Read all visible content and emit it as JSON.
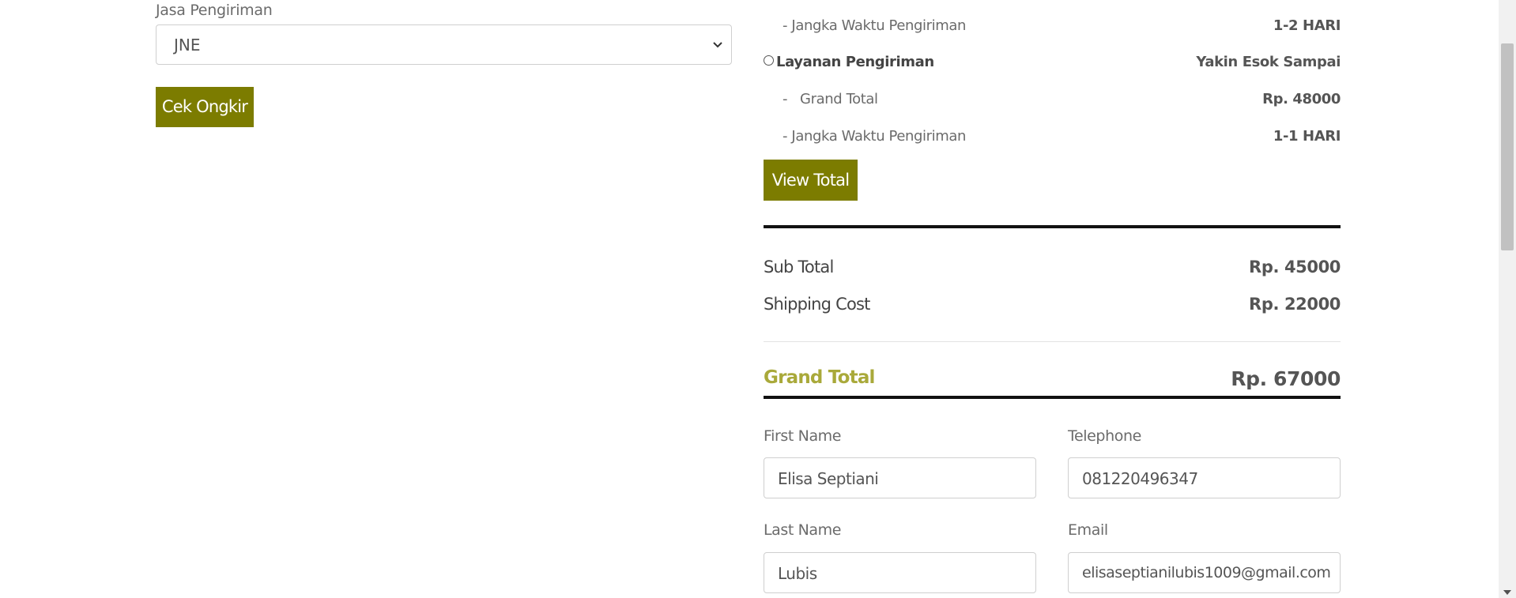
{
  "shipping_form": {
    "courier_label": "Jasa Pengiriman",
    "courier_selected": "JNE",
    "check_button": "Cek Ongkir"
  },
  "shipping_options": {
    "duration_label_1": "- Jangka Waktu Pengiriman",
    "duration_value_1": "1-2 HARI",
    "service_label": "Layanan Pengiriman",
    "service_value": "Yakin Esok Sampai",
    "grand_total_label": "-   Grand Total",
    "grand_total_value": "Rp. 48000",
    "duration_label_2": "- Jangka Waktu Pengiriman",
    "duration_value_2": "1-1 HARI",
    "view_total_button": "View Total"
  },
  "summary": {
    "subtotal_label": "Sub Total",
    "subtotal_value": "Rp. 45000",
    "shipping_label": "Shipping Cost",
    "shipping_value": "Rp. 22000",
    "grand_total_label": "Grand Total",
    "grand_total_value": "Rp. 67000"
  },
  "customer_form": {
    "first_name_label": "First Name",
    "first_name_value": "Elisa Septiani",
    "telephone_label": "Telephone",
    "telephone_value": "081220496347",
    "last_name_label": "Last Name",
    "last_name_value": "Lubis",
    "email_label": "Email",
    "email_value": "elisaseptianilubis1009@gmail.com"
  },
  "colors": {
    "accent_button": "#7c7c00",
    "grand_total_accent": "#a9a93a"
  },
  "icons": {
    "select_arrow": "chevron-down-icon",
    "radio": "radio-unchecked-icon",
    "scroll_down": "scroll-down-arrow-icon"
  }
}
